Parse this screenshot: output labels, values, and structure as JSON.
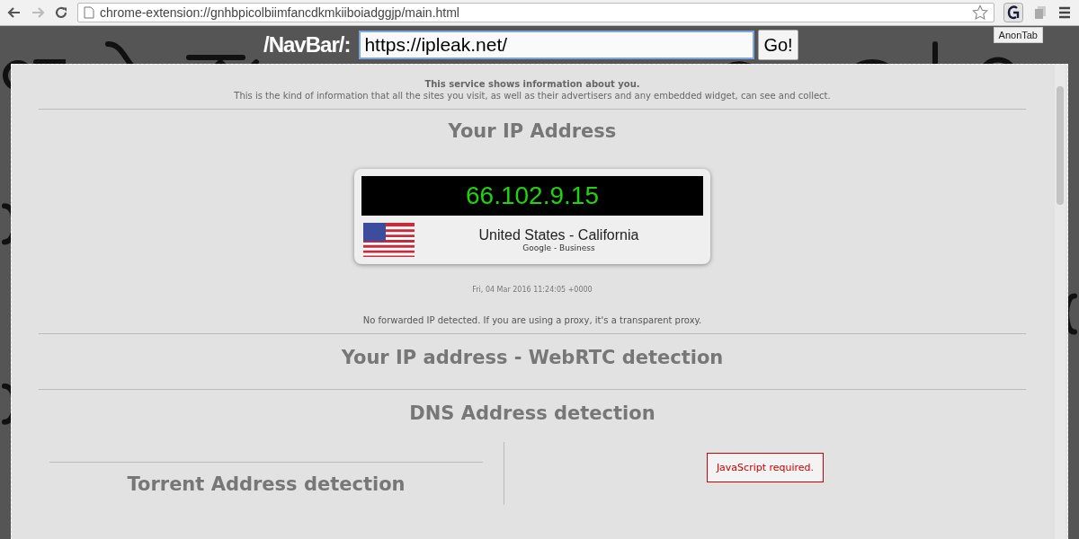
{
  "browser": {
    "url": "chrome-extension://gnhbpicolbiimfancdkmkiiboiadggjp/main.html",
    "tooltip": "AnonTab"
  },
  "navbar": {
    "label": "/NavBar/:",
    "value": "https://ipleak.net/",
    "button": "Go!"
  },
  "intro": {
    "title": "This service shows information about you.",
    "text": "This is the kind of information that all the sites you visit, as well as their advertisers and any embedded widget, can see and collect."
  },
  "ip_section": {
    "heading": "Your IP Address",
    "ip": "66.102.9.15",
    "location": "United States - California",
    "isp": "Google - Business",
    "timestamp": "Fri, 04 Mar 2016 11:24:05 +0000",
    "note": "No forwarded IP detected. If you are using a proxy, it's a transparent proxy."
  },
  "sections": [
    {
      "heading": "Your IP address - WebRTC detection"
    },
    {
      "heading": "DNS Address detection"
    }
  ],
  "torrent": {
    "heading": "Torrent Address detection",
    "notice": "JavaScript required."
  }
}
